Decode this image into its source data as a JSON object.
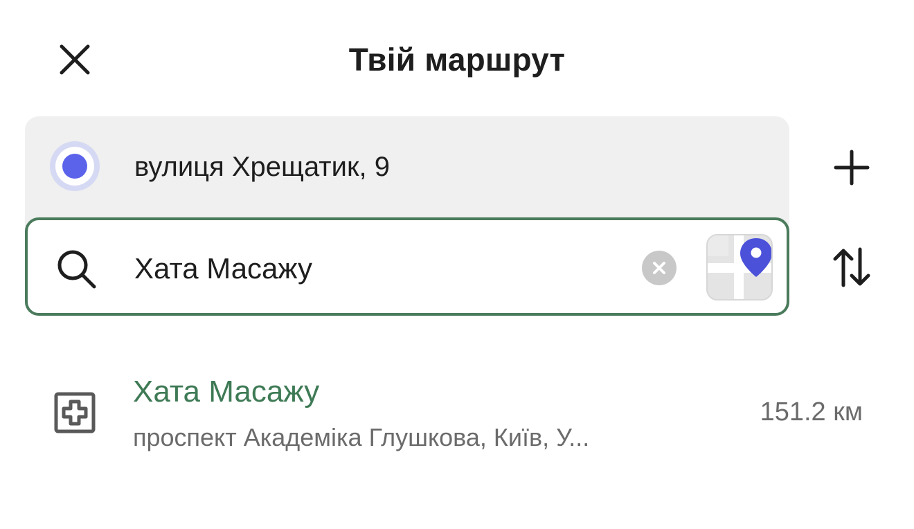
{
  "header": {
    "title": "Твій маршрут",
    "close_icon": "close-icon"
  },
  "route": {
    "origin": {
      "text": "вулиця Хрещатик, 9",
      "icon": "origin-dot-icon",
      "color": "#5b63ea"
    },
    "destination": {
      "value": "Хата Масажу",
      "search_icon": "search-icon",
      "clear_icon": "clear-icon",
      "map_icon": "map-pin-icon",
      "border_color": "#4a7b5c"
    },
    "add_icon": "plus-icon",
    "swap_icon": "swap-arrows-icon"
  },
  "results": [
    {
      "title": "Хата Масажу",
      "address": "проспект Академіка Глушкова, Київ, У...",
      "distance": "151.2 км",
      "icon": "medical-cross-icon",
      "title_color": "#3e7a55"
    }
  ]
}
